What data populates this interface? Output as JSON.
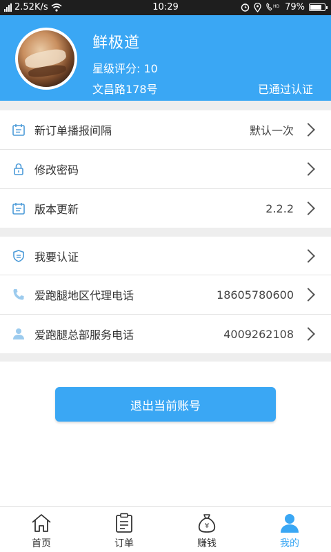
{
  "status_bar": {
    "speed": "2.52K/s",
    "time": "10:29",
    "battery": "79%",
    "battery_level": 0.79
  },
  "profile": {
    "shop_name": "鲜极道",
    "rating": "星级评分: 10",
    "address": "文昌路178号",
    "verification": "已通过认证"
  },
  "settings_group1": [
    {
      "label": "新订单播报间隔",
      "value": "默认一次",
      "icon": "calendar-icon"
    },
    {
      "label": "修改密码",
      "value": "",
      "icon": "lock-icon"
    },
    {
      "label": "版本更新",
      "value": "2.2.2",
      "icon": "calendar-icon"
    }
  ],
  "settings_group2": [
    {
      "label": "我要认证",
      "value": "",
      "icon": "badge-icon"
    },
    {
      "label": "爱跑腿地区代理电话",
      "value": "18605780600",
      "icon": "phone-icon"
    },
    {
      "label": "爱跑腿总部服务电话",
      "value": "4009262108",
      "icon": "person-icon"
    }
  ],
  "logout_label": "退出当前账号",
  "tabs": [
    {
      "label": "首页",
      "icon": "home-icon"
    },
    {
      "label": "订单",
      "icon": "order-icon"
    },
    {
      "label": "赚钱",
      "icon": "money-bag-icon"
    },
    {
      "label": "我的",
      "icon": "person-icon"
    }
  ],
  "colors": {
    "accent": "#3aa7f4",
    "icon_blue": "#4a9ad8",
    "status_bar": "#1e1e1e",
    "section_gap": "#eeeeee"
  }
}
